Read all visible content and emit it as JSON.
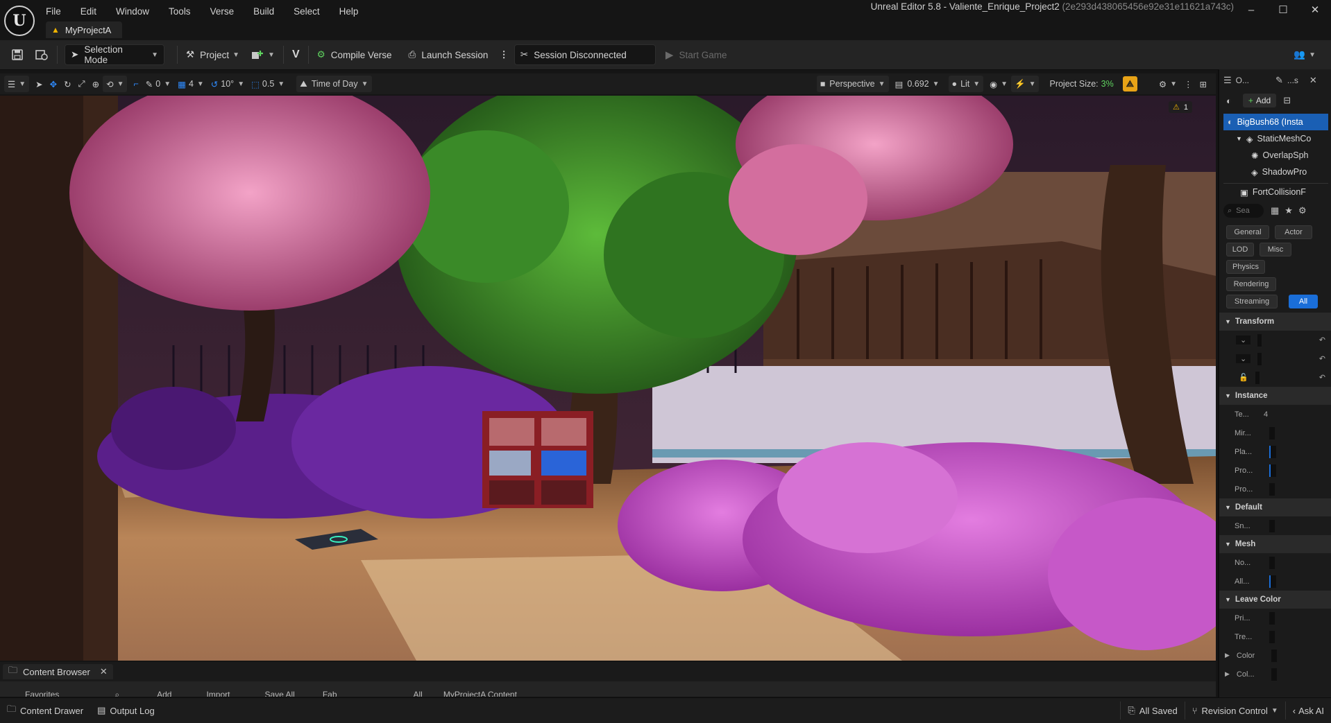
{
  "menu": [
    "File",
    "Edit",
    "Window",
    "Tools",
    "Verse",
    "Build",
    "Select",
    "Help"
  ],
  "project_tab": "MyProjectA",
  "window_title": "Unreal Editor 5.8 - Valiente_Enrique_Project2",
  "window_hash": "(2e293d438065456e92e31e11621a743c)",
  "toolbar": {
    "selection_mode": "Selection Mode",
    "project": "Project",
    "compile_verse": "Compile Verse",
    "launch_session": "Launch Session",
    "session_status": "Session Disconnected",
    "start_game": "Start Game"
  },
  "viewport_toolbar": {
    "rotate_snap_count": "0",
    "grid_snap": "4",
    "angle_snap": "10°",
    "scale_snap": "0.5",
    "time_of_day": "Time of Day",
    "perspective": "Perspective",
    "fov_value": "0.692",
    "lit": "Lit",
    "project_size_label": "Project Size:",
    "project_size_value": "3%"
  },
  "viewport": {
    "warning_count": "1"
  },
  "outliner": {
    "tab_label": "O...",
    "details_tab_label": "...s",
    "add_label": "Add",
    "items": [
      "BigBush68 (Insta",
      "StaticMeshCo",
      "OverlapSph",
      "ShadowPro",
      "FortCollisionF"
    ],
    "search_placeholder": "Sea"
  },
  "details": {
    "categories": [
      "General",
      "Actor",
      "LOD",
      "Misc",
      "Physics",
      "Rendering",
      "Streaming",
      "All"
    ],
    "sections": {
      "transform": "Transform",
      "instance": "Instance",
      "default": "Default",
      "mesh": "Mesh",
      "leave_color": "Leave Color"
    },
    "instance_props": [
      "Te...",
      "Mir...",
      "Pla...",
      "Pro...",
      "Pro..."
    ],
    "default_props": [
      "Sn..."
    ],
    "mesh_props": [
      "No...",
      "All..."
    ],
    "leave_props": [
      "Pri...",
      "Tre..."
    ],
    "collapsed_props": [
      "Color",
      "Col..."
    ]
  },
  "content_browser": {
    "tab_label": "Content Browser",
    "cut_row": [
      "Favorites",
      "Add",
      "Import",
      "Save All",
      "Fab",
      "All",
      "MyProjectA Content"
    ]
  },
  "statusbar": {
    "content_drawer": "Content Drawer",
    "output_log": "Output Log",
    "all_saved": "All Saved",
    "revision_control": "Revision Control",
    "ask_ai": "Ask AI"
  },
  "colors": {
    "accent_blue": "#1a6ed8",
    "project_size_green": "#5fd35f",
    "warning_yellow": "#f0b400",
    "scalability_orange": "#e8a317"
  }
}
